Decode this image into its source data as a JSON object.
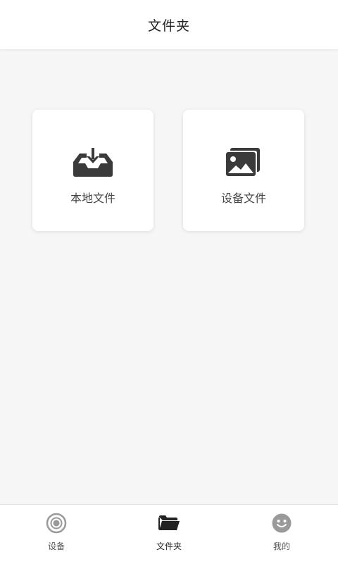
{
  "header": {
    "title": "文件夹"
  },
  "cards": [
    {
      "label": "本地文件",
      "icon": "inbox-download-icon"
    },
    {
      "label": "设备文件",
      "icon": "image-stack-icon"
    }
  ],
  "tabbar": {
    "tabs": [
      {
        "label": "设备",
        "icon": "device-icon",
        "active": false
      },
      {
        "label": "文件夹",
        "icon": "folder-icon",
        "active": true
      },
      {
        "label": "我的",
        "icon": "smiley-icon",
        "active": false
      }
    ]
  },
  "colors": {
    "background": "#f6f6f6",
    "icon": "#3a3a3a",
    "inactive_icon": "#9a9a9a"
  }
}
